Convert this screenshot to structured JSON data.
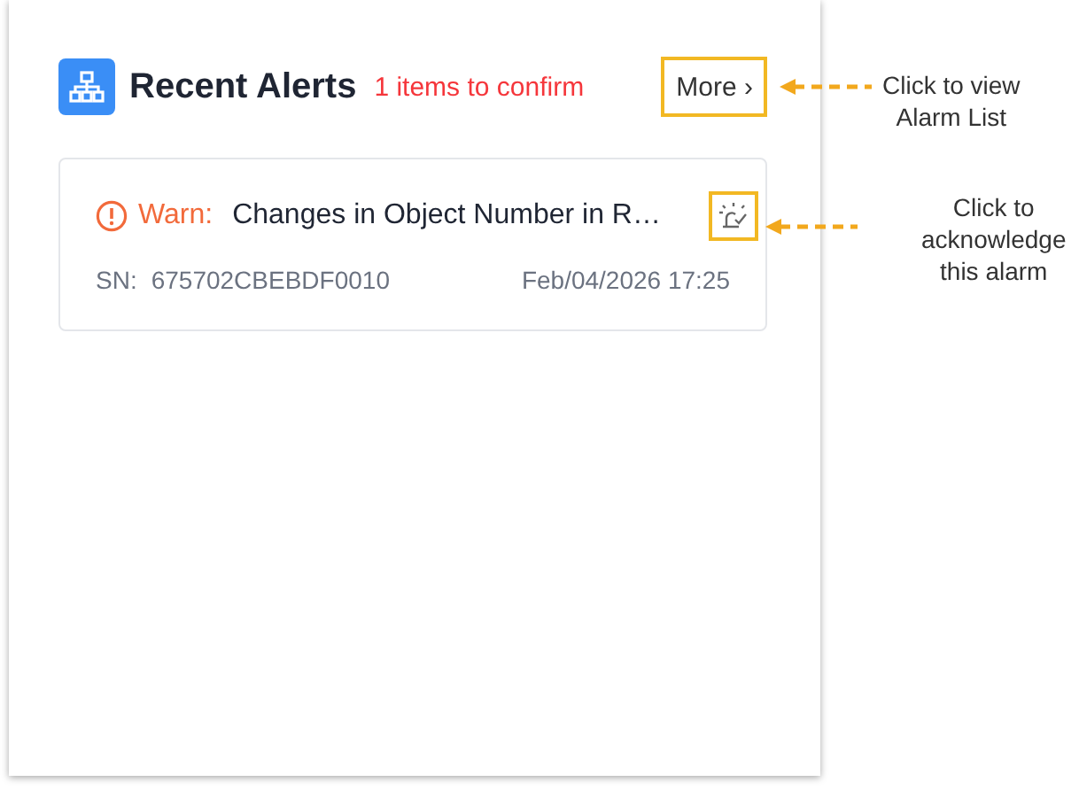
{
  "panel": {
    "title": "Recent Alerts",
    "pending": "1 items to confirm",
    "more": "More ›"
  },
  "alerts": [
    {
      "level": "Warn:",
      "message": "Changes in Object Number in R…",
      "sn_label": "SN:",
      "sn": "675702CBEBDF0010",
      "time": "Feb/04/2026 17:25"
    }
  ],
  "annotations": [
    {
      "text": "Click to view\nAlarm List"
    },
    {
      "text": "Click to\nacknowledge\nthis alarm"
    }
  ]
}
